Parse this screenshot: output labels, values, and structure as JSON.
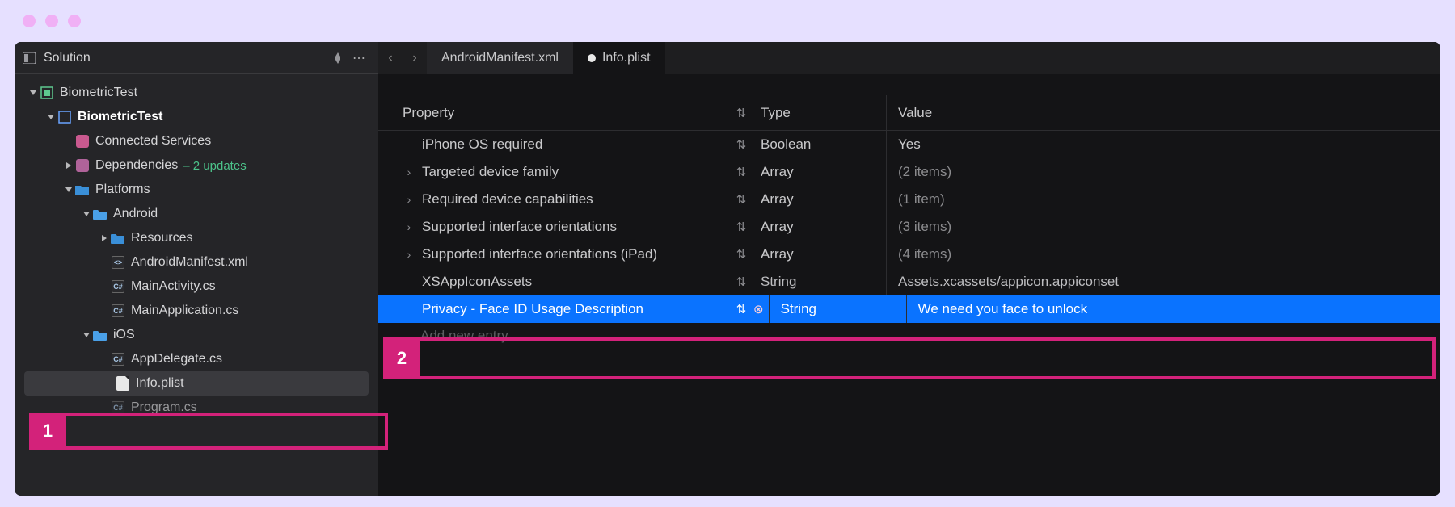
{
  "sidebar": {
    "title": "Solution",
    "tree": {
      "root": {
        "label": "BiometricTest"
      },
      "project": {
        "label": "BiometricTest"
      },
      "connected_services": "Connected Services",
      "dependencies": {
        "label": "Dependencies",
        "updates": "– 2 updates"
      },
      "platforms": "Platforms",
      "android": "Android",
      "android_resources": "Resources",
      "android_manifest": "AndroidManifest.xml",
      "android_mainactivity": "MainActivity.cs",
      "android_mainapplication": "MainApplication.cs",
      "ios": "iOS",
      "ios_appdelegate": "AppDelegate.cs",
      "ios_infoplist": "Info.plist",
      "ios_program": "Program.cs"
    }
  },
  "tabs": {
    "inactive": "AndroidManifest.xml",
    "active": "Info.plist"
  },
  "plist": {
    "headers": {
      "property": "Property",
      "type": "Type",
      "value": "Value"
    },
    "rows": [
      {
        "prop": "iPhone OS required",
        "type": "Boolean",
        "value": "Yes",
        "expandable": false
      },
      {
        "prop": "Targeted device family",
        "type": "Array",
        "value": "(2 items)",
        "expandable": true
      },
      {
        "prop": "Required device capabilities",
        "type": "Array",
        "value": "(1 item)",
        "expandable": true
      },
      {
        "prop": "Supported interface orientations",
        "type": "Array",
        "value": "(3 items)",
        "expandable": true
      },
      {
        "prop": "Supported interface orientations (iPad)",
        "type": "Array",
        "value": "(4 items)",
        "expandable": true
      },
      {
        "prop": "XSAppIconAssets",
        "type": "String",
        "value": "Assets.xcassets/appicon.appiconset",
        "expandable": false,
        "cutoff": true
      },
      {
        "prop": "Privacy - Face ID Usage Description",
        "type": "String",
        "value": "We need you face to  unlock",
        "expandable": false,
        "selected": true,
        "deletable": true
      }
    ],
    "add_new": "Add new entry"
  },
  "callouts": {
    "one": "1",
    "two": "2"
  }
}
